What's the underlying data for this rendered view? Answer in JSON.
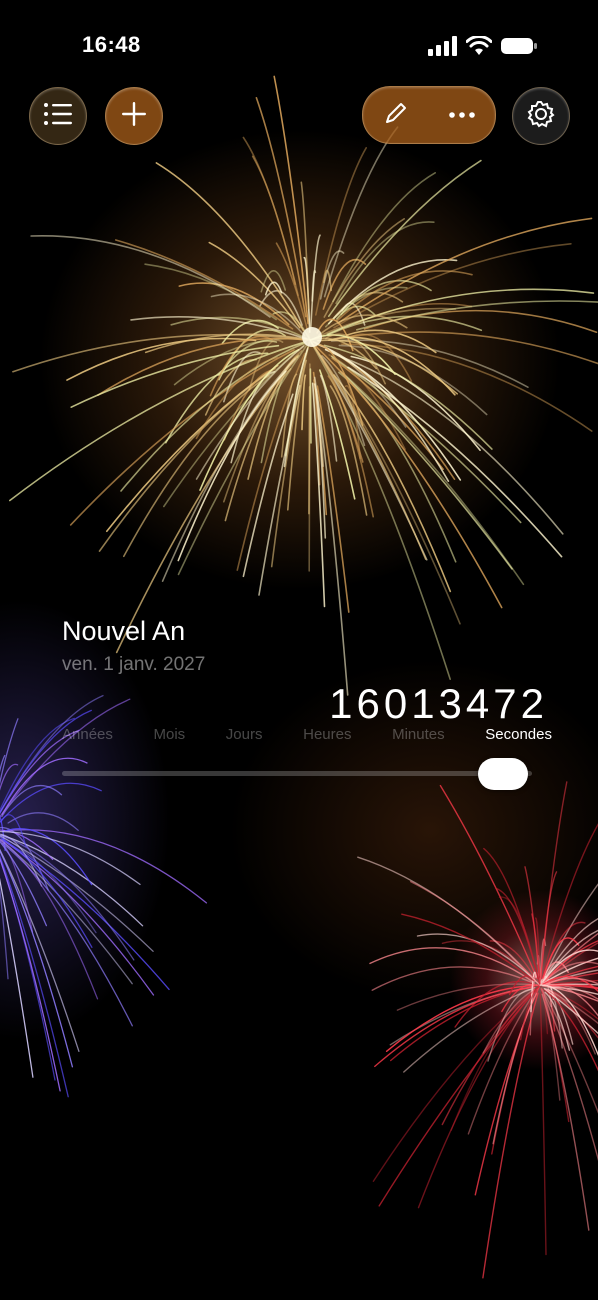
{
  "status_bar": {
    "time": "16:48",
    "icons": [
      "signal-icon",
      "wifi-icon",
      "battery-icon"
    ]
  },
  "toolbar": {
    "left": [
      "list-icon",
      "plus-icon"
    ],
    "pill": [
      "pencil-icon",
      "more-icon"
    ],
    "right": [
      "gear-icon"
    ],
    "accent": "#AA5F19"
  },
  "event": {
    "title": "Nouvel An",
    "date": "ven. 1 janv. 2027",
    "counter": "16013472"
  },
  "units": {
    "items": [
      "Années",
      "Mois",
      "Jours",
      "Heures",
      "Minutes",
      "Secondes"
    ],
    "selected": "Secondes",
    "selected_index": 5
  }
}
